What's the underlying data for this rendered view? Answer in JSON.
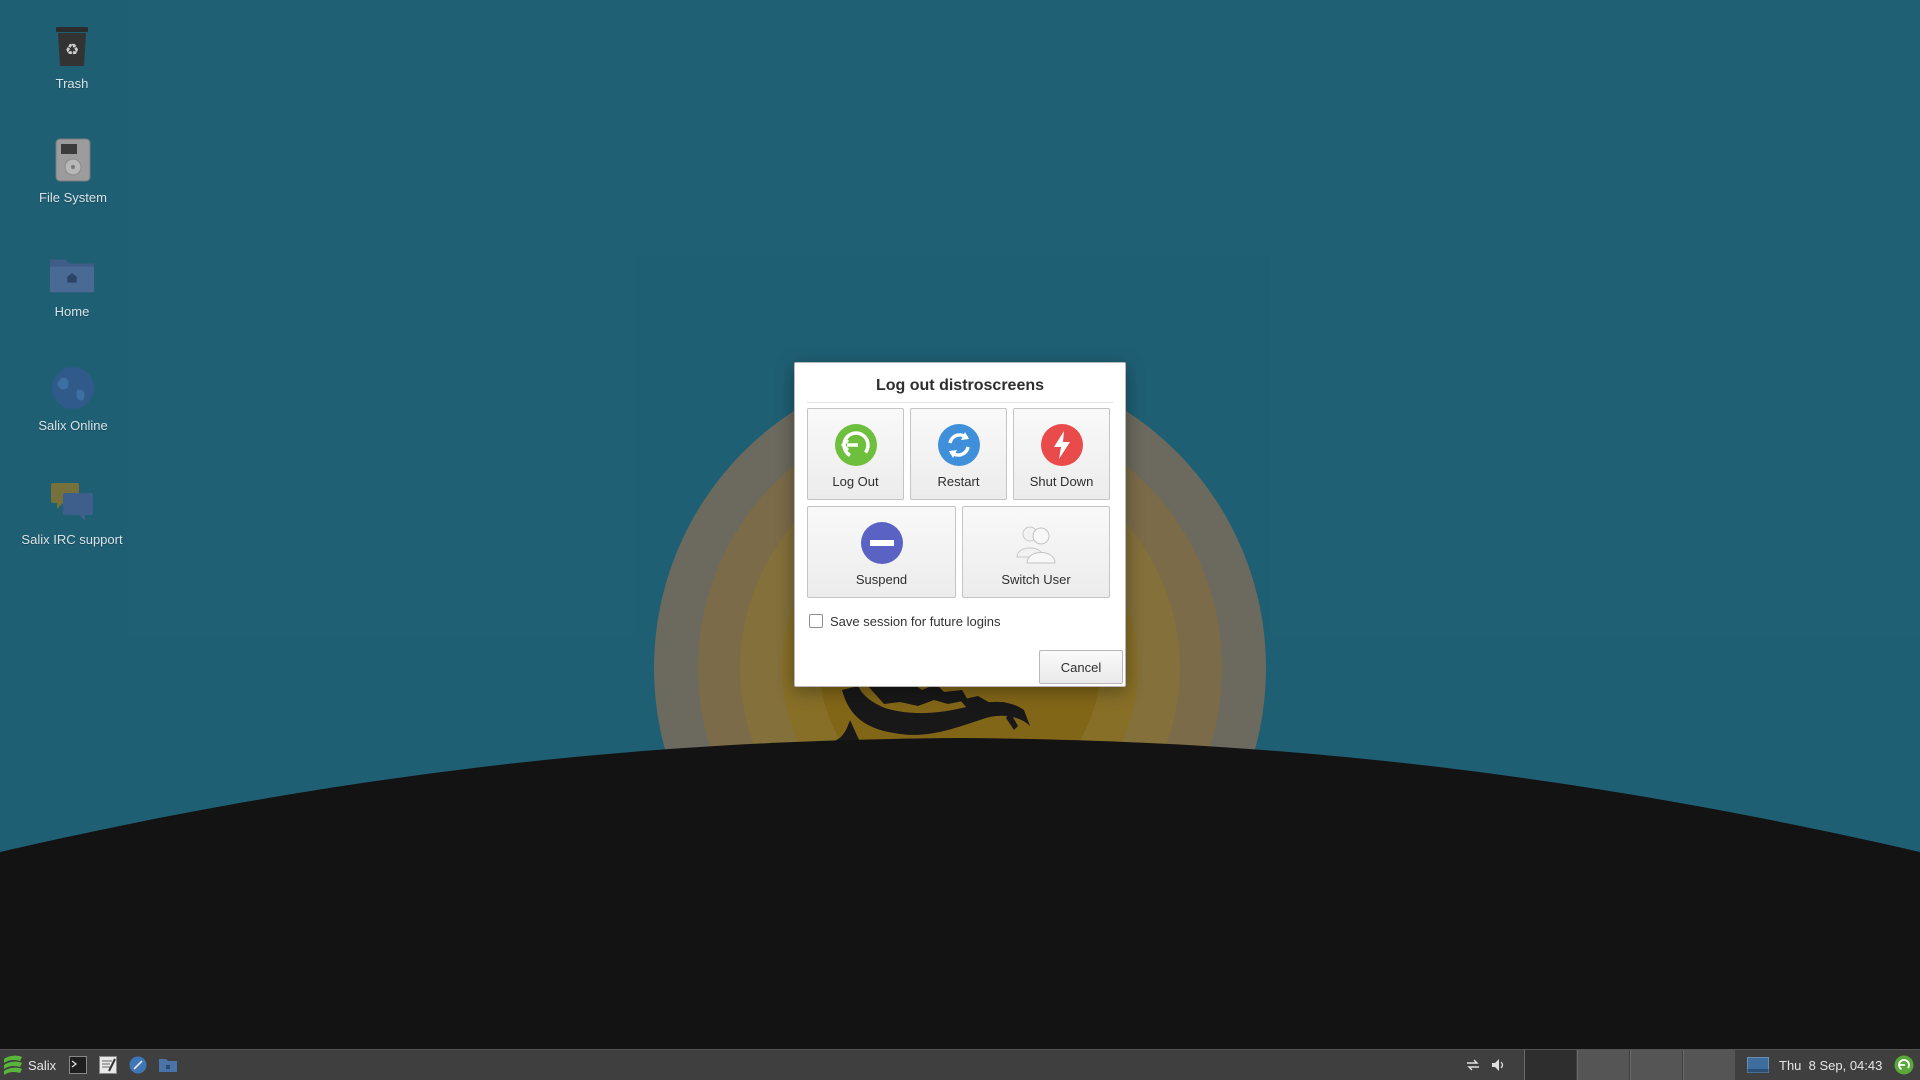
{
  "desktop_icons": [
    {
      "label": "Trash",
      "icon": "trash-icon"
    },
    {
      "label": "File System",
      "icon": "drive-icon"
    },
    {
      "label": "Home",
      "icon": "home-folder-icon"
    },
    {
      "label": "Salix Online",
      "icon": "globe-icon"
    },
    {
      "label": "Salix IRC support",
      "icon": "chat-icon"
    }
  ],
  "dialog": {
    "title": "Log out distroscreens",
    "actions": [
      {
        "label": "Log Out",
        "icon": "logout-icon",
        "color": "#6fbf3f"
      },
      {
        "label": "Restart",
        "icon": "restart-icon",
        "color": "#3f8fdb"
      },
      {
        "label": "Shut Down",
        "icon": "shutdown-icon",
        "color": "#e94a4a"
      },
      {
        "label": "Suspend",
        "icon": "suspend-icon",
        "color": "#5a63c4"
      },
      {
        "label": "Switch User",
        "icon": "switch-user-icon",
        "color": "#d8d8d8"
      }
    ],
    "save_session_label": "Save session for future logins",
    "save_session_checked": false,
    "cancel_label": "Cancel"
  },
  "taskbar": {
    "menu_label": "Salix",
    "launchers": [
      "terminal-icon",
      "text-editor-icon",
      "web-browser-icon",
      "file-manager-icon"
    ],
    "tray": [
      "network-icon",
      "volume-icon"
    ],
    "workspaces": 4,
    "active_workspace": 1,
    "clock": "Thu  8 Sep, 04:43"
  },
  "colors": {
    "desktop_background": "#22687e",
    "taskbar_background": "#3f3f3f",
    "ground": "#151515"
  }
}
